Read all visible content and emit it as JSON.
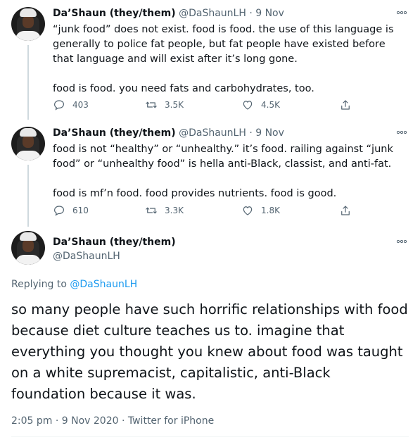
{
  "tweets": [
    {
      "name": "Da’Shaun (they/them)",
      "handle": "@DaShaunLH",
      "separator": "·",
      "date": "9 Nov",
      "paragraphs": [
        "“junk food” does not exist. food is food. the use of this language is generally to police fat people, but fat people have existed before that language and will exist after it’s long gone.",
        "food is food. you need fats and carbohydrates, too."
      ],
      "replies": "403",
      "retweets": "3.5K",
      "likes": "4.5K"
    },
    {
      "name": "Da’Shaun (they/them)",
      "handle": "@DaShaunLH",
      "separator": "·",
      "date": "9 Nov",
      "paragraphs": [
        "food is not “healthy” or “unhealthy.” it’s food. railing against “junk food” or “unhealthy food” is hella anti-Black, classist, and anti-fat.",
        "food is mf’n food. food provides nutrients. food is good."
      ],
      "replies": "610",
      "retweets": "3.3K",
      "likes": "1.8K"
    }
  ],
  "main": {
    "name": "Da’Shaun (they/them)",
    "handle": "@DaShaunLH",
    "replying_prefix": "Replying to ",
    "replying_to": "@DaShaunLH",
    "text": "so many people have such horrific relationships with food because diet culture teaches us to. imagine that everything you thought you knew about food was taught on a white supremacist, capitalistic, anti-Black foundation because it was.",
    "meta": "2:05 pm · 9 Nov 2020 · Twitter for iPhone"
  },
  "icons": {
    "more": "more-icon",
    "reply": "reply-icon",
    "retweet": "retweet-icon",
    "like": "like-icon",
    "share": "share-icon"
  },
  "colors": {
    "text": "#0f1419",
    "secondary": "#536471",
    "link": "#1d9bf0",
    "thread_line": "#cfd9de"
  }
}
